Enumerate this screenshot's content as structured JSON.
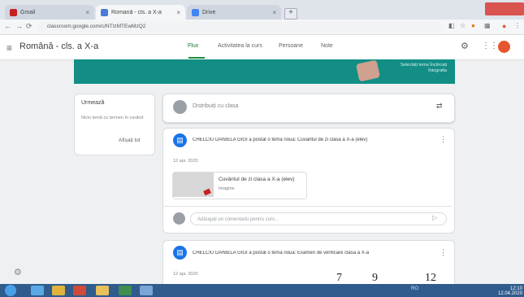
{
  "browser": {
    "tabs": [
      {
        "label": "Gmail",
        "favicon_color": "#c5221f"
      },
      {
        "label": "Romană - cls. a X-a",
        "favicon_color": "#1a73e8"
      },
      {
        "label": "Drive",
        "favicon_color": "#4285f4"
      }
    ],
    "url": "classroom.google.com/c/NTIzMTEwMzQ2"
  },
  "app": {
    "class_title": "Română - cls. a X-a",
    "nav_tabs": [
      "Flux",
      "Activitatea la curs",
      "Persoane",
      "Note"
    ],
    "active_tab_index": 0,
    "banner_text": "Selectați tema  Încărcați fotografia"
  },
  "upcoming": {
    "title": "Urmează",
    "text": "Nicio temă cu termen în curând",
    "link": "Afișați tot"
  },
  "share": {
    "placeholder": "Distribuiți cu clasa"
  },
  "posts": [
    {
      "text": "CHELCIU DANIELA GIGI a postat o temă nouă: Cuvântul de zi clasa a X-a (elev)",
      "date": "12 apr. 2020",
      "attachment": {
        "title": "Cuvântul de zi clasa a X-a (elev)",
        "type": "Imagine"
      },
      "comment_placeholder": "Adăugați un comentariu pentru curs..."
    },
    {
      "text": "CHELCIU DANIELA GIGI a postat o temă nouă: Examen de verificare clasa a X-a",
      "date": "12 apr. 2020"
    }
  ],
  "overlay_numbers": [
    "7",
    "9",
    "12"
  ],
  "taskbar": {
    "clock_time": "12:10",
    "clock_date": "12.04.2020",
    "tray_language": "RO"
  },
  "colors": {
    "accent_green": "#1e8e3e",
    "banner_teal": "#128e85",
    "post_icon_blue": "#1a73e8",
    "avatar_orange": "#e4572e",
    "taskbar_blue": "#2f5b8d"
  }
}
